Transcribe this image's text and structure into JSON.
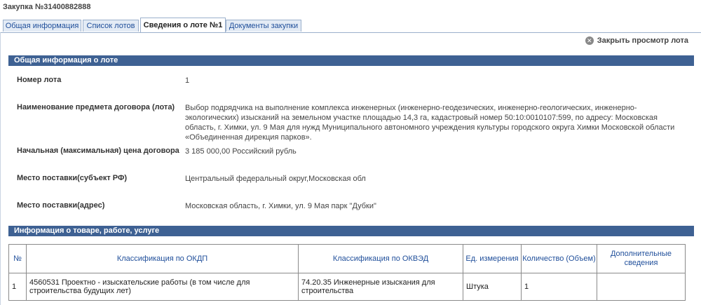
{
  "page_title": "Закупка №31400882888",
  "tabs": [
    {
      "label": "Общая информация",
      "active": false
    },
    {
      "label": "Список лотов",
      "active": false
    },
    {
      "label": "Сведения о лоте №1",
      "active": true
    },
    {
      "label": "Документы закупки",
      "active": false
    }
  ],
  "close_label": "Закрыть просмотр лота",
  "section1_title": "Общая информация о лоте",
  "fields": [
    {
      "label": "Номер лота",
      "value": "1"
    },
    {
      "label": "Наименование предмета договора (лота)",
      "value": "Выбор подрядчика на выполнение комплекса инженерных (инженерно-геодезических, инженерно-геологических, инженерно-экологических) изысканий на земельном участке площадью 14,3 га, кадастровый номер 50:10:0010107:599, по адресу: Московская область, г. Химки, ул. 9 Мая для нужд Муниципального автономного учреждения культуры городского округа Химки Московской области «Объединенная дирекция парков»."
    },
    {
      "label": "Начальная (максимальная) цена договора",
      "value": "3 185 000,00 Российский рубль"
    },
    {
      "label": "Место поставки(субъект РФ)",
      "value": "Центральный федеральный округ,Московская обл"
    },
    {
      "label": "Место поставки(адрес)",
      "value": "Московская область, г. Химки, ул. 9 Мая парк \"Дубки\""
    }
  ],
  "section2_title": "Информация о товаре, работе, услуге",
  "goods_table": {
    "headers": [
      "№",
      "Классификация по ОКДП",
      "Классификация по ОКВЭД",
      "Ед. измерения",
      "Количество (Объем)",
      "Дополнительные сведения"
    ],
    "rows": [
      [
        "1",
        "4560531 Проектно - изыскательские работы (в том числе для строительства будущих лет)",
        "74.20.35 Инженерные изыскания для строительства",
        "Штука",
        "1",
        ""
      ]
    ]
  }
}
